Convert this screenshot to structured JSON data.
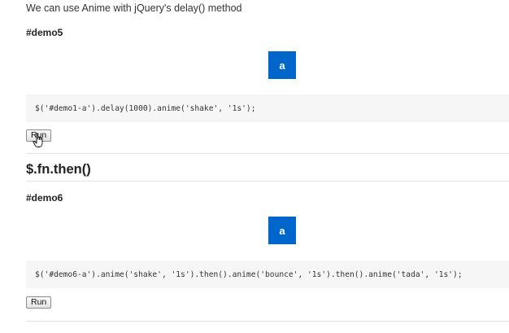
{
  "intro_text": "We can use Anime with jQuery's delay() method",
  "demo5": {
    "label": "#demo5",
    "box_text": "a",
    "code": "$('#demo1-a').delay(1000).anime('shake', '1s');",
    "run_label": "Run"
  },
  "section": {
    "title": "$.fn.then()"
  },
  "demo6": {
    "label": "#demo6",
    "box_text": "a",
    "code": "$('#demo6-a').anime('shake', '1s').then().anime('bounce', '1s').then().anime('tada', '1s');",
    "run_label": "Run"
  },
  "colors": {
    "box": "#0066cc",
    "code_bg": "#f6f6f6"
  },
  "icons": {
    "cursor": "hand-pointer-icon"
  }
}
